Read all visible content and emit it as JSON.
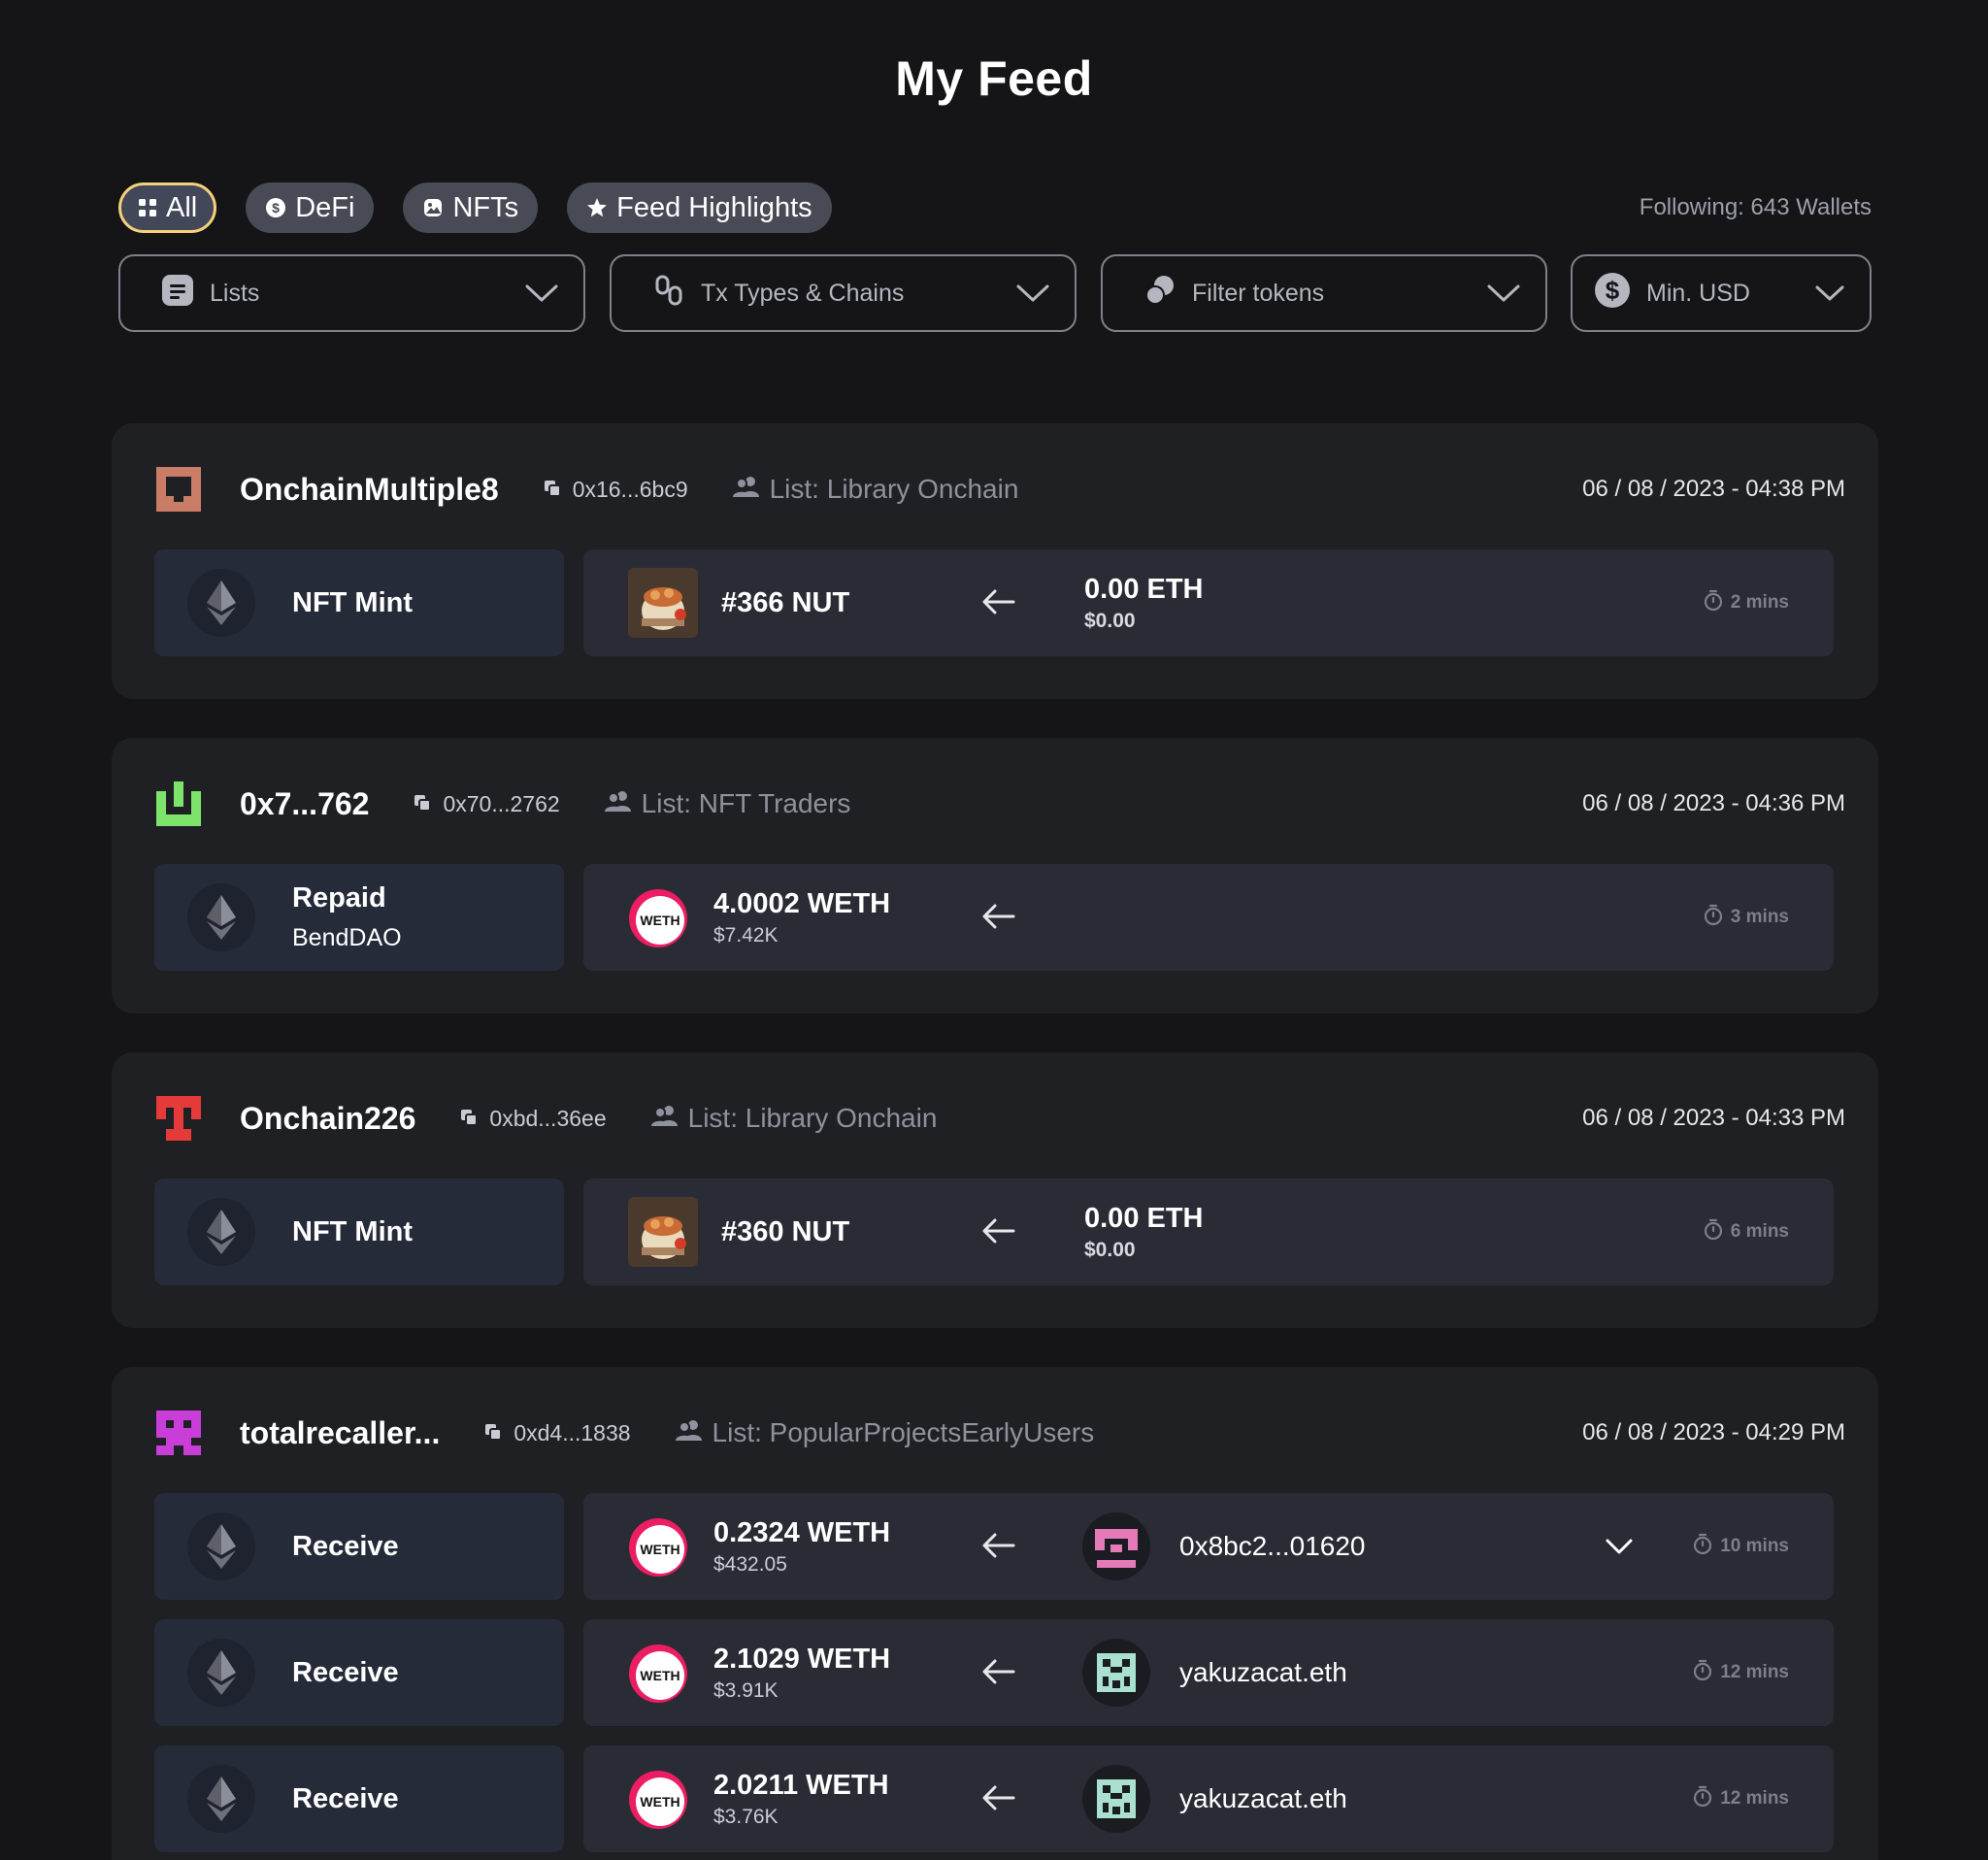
{
  "page": {
    "title": "My Feed"
  },
  "tabs": [
    {
      "label": "All",
      "icon": "grid-icon",
      "active": true
    },
    {
      "label": "DeFi",
      "icon": "dollar-coin-icon",
      "active": false
    },
    {
      "label": "NFTs",
      "icon": "image-icon",
      "active": false
    },
    {
      "label": "Feed Highlights",
      "icon": "star-icon",
      "active": false
    }
  ],
  "following": "Following: 643 Wallets",
  "filters": {
    "lists": "Lists",
    "tx_types": "Tx Types & Chains",
    "tokens": "Filter tokens",
    "min_usd": "Min. USD"
  },
  "colors": {
    "background": "#151517",
    "card": "#1f2024",
    "tab_active_border": "#f4d27a",
    "type_box": "#262b3a",
    "detail_box": "#2a2c35"
  },
  "cards": [
    {
      "name": "OnchainMultiple8",
      "address": "0x16...6bc9",
      "list": "List: Library Onchain",
      "date": "06 / 08 / 2023 - 04:38 PM",
      "rows": [
        {
          "type": "NFT Mint",
          "sub": "",
          "asset": "#366 NUT",
          "usd": "",
          "counter_amount": "0.00 ETH",
          "counter_usd": "$0.00",
          "time": "2 mins"
        }
      ]
    },
    {
      "name": "0x7...762",
      "address": "0x70...2762",
      "list": "List: NFT Traders",
      "date": "06 / 08 / 2023 - 04:36 PM",
      "rows": [
        {
          "type": "Repaid",
          "sub": "BendDAO",
          "asset": "4.0002 WETH",
          "usd": "$7.42K",
          "time": "3 mins"
        }
      ]
    },
    {
      "name": "Onchain226",
      "address": "0xbd...36ee",
      "list": "List: Library Onchain",
      "date": "06 / 08 / 2023 - 04:33 PM",
      "rows": [
        {
          "type": "NFT Mint",
          "sub": "",
          "asset": "#360 NUT",
          "usd": "",
          "counter_amount": "0.00 ETH",
          "counter_usd": "$0.00",
          "time": "6 mins"
        }
      ]
    },
    {
      "name": "totalrecaller...",
      "address": "0xd4...1838",
      "list": "List: PopularProjectsEarlyUsers",
      "date": "06 / 08 / 2023 - 04:29 PM",
      "rows": [
        {
          "type": "Receive",
          "asset": "0.2324 WETH",
          "usd": "$432.05",
          "counterparty": "0x8bc2...01620",
          "time": "10 mins"
        },
        {
          "type": "Receive",
          "asset": "2.1029 WETH",
          "usd": "$3.91K",
          "counterparty": "yakuzacat.eth",
          "time": "12 mins"
        },
        {
          "type": "Receive",
          "asset": "2.0211 WETH",
          "usd": "$3.76K",
          "counterparty": "yakuzacat.eth",
          "time": "12 mins"
        }
      ]
    }
  ]
}
